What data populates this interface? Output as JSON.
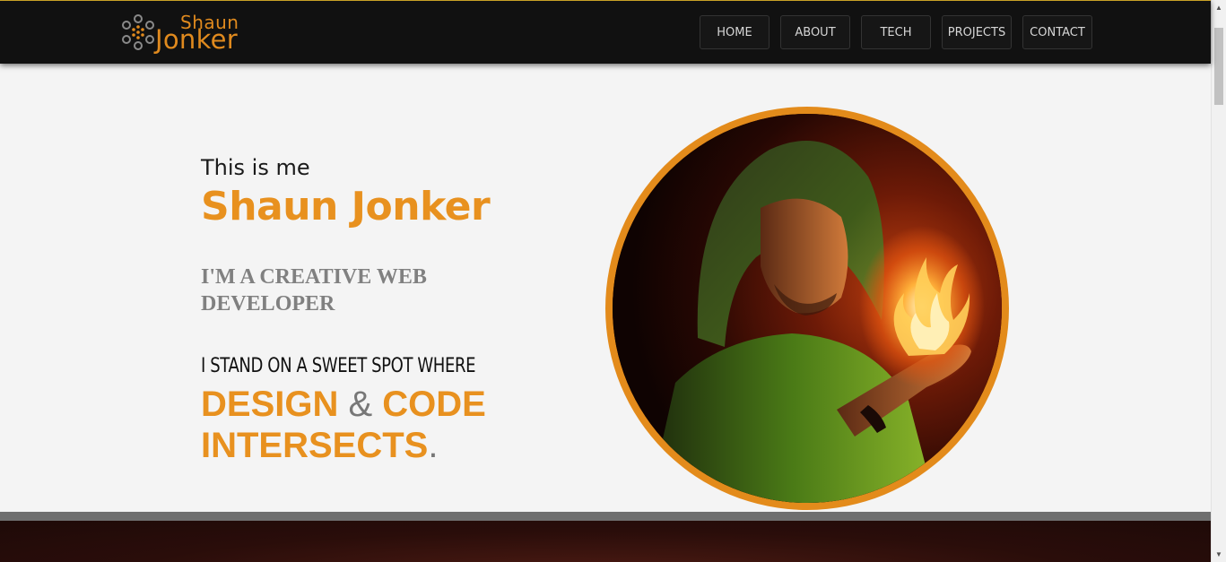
{
  "header": {
    "logo": {
      "first": "Shaun",
      "last": "Jonker",
      "icon": "dots-circle-icon"
    },
    "nav": [
      {
        "label": "HOME"
      },
      {
        "label": "ABOUT"
      },
      {
        "label": "TECH"
      },
      {
        "label": "PROJECTS"
      },
      {
        "label": "CONTACT"
      }
    ]
  },
  "hero": {
    "intro": "This is me",
    "name": "Shaun Jonker",
    "role": "I'M A CREATIVE WEB DEVELOPER",
    "tagline_lead": "I STAND ON A SWEET SPOT WHERE",
    "tagline_word1": "DESIGN",
    "tagline_amp": "&",
    "tagline_word2": "CODE",
    "tagline_word3": "INTERSECTS",
    "tagline_dot": "."
  },
  "colors": {
    "accent": "#e8911f",
    "header_bg": "#111111",
    "page_bg": "#f4f4f4",
    "role_gray": "#808080"
  }
}
